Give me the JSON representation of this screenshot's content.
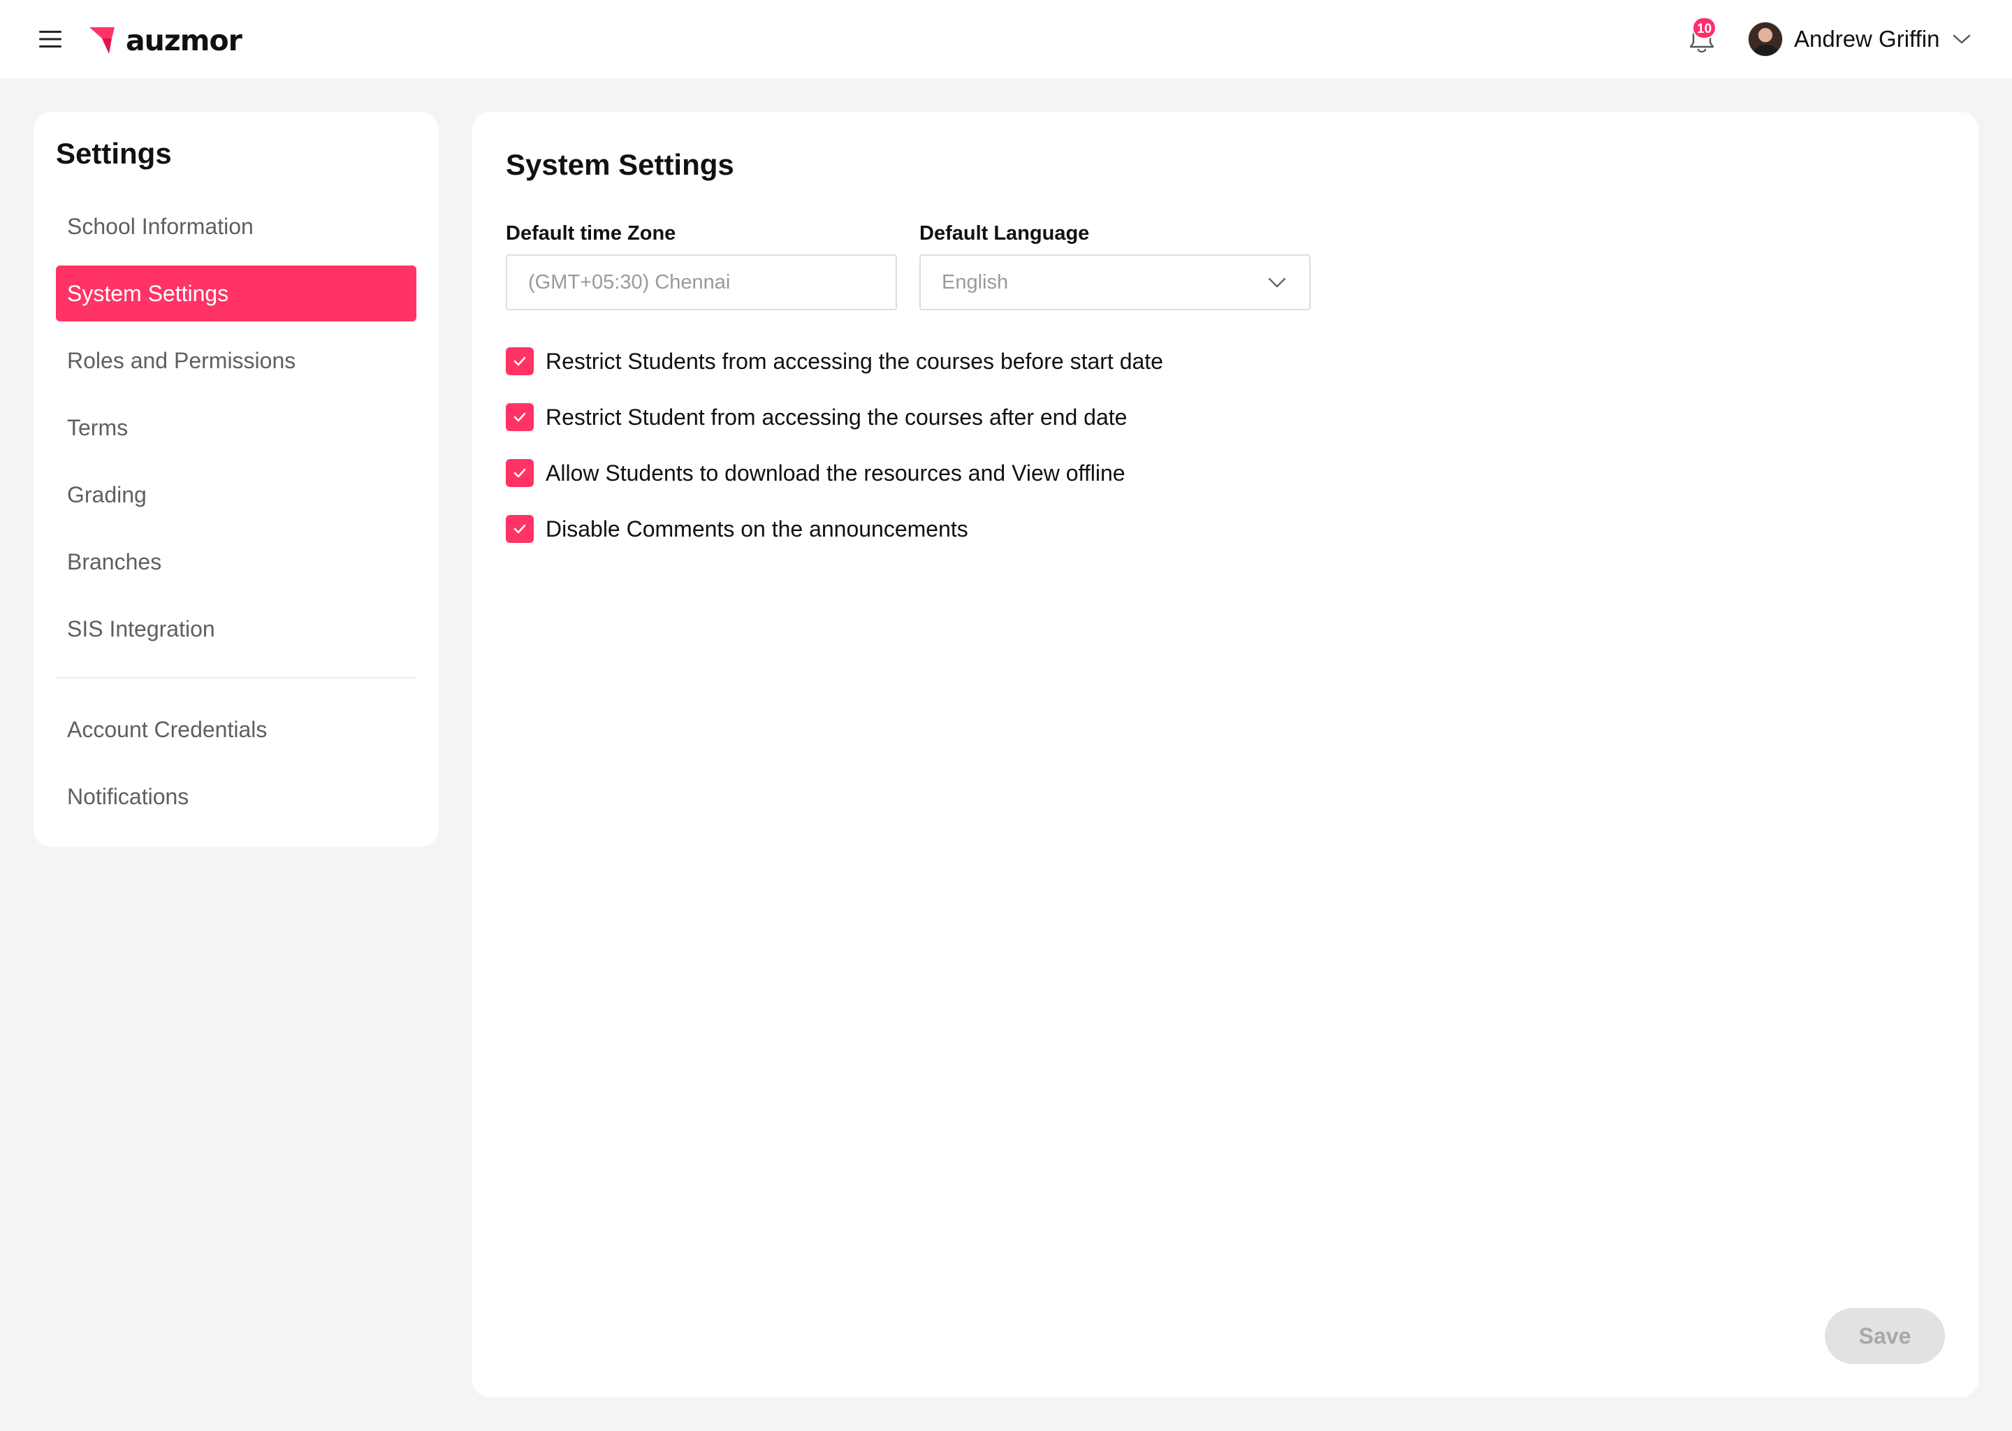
{
  "header": {
    "brand": "auzmor",
    "notification_count": "10",
    "user_name": "Andrew Griffin",
    "icons": {
      "menu": "hamburger-menu-icon",
      "notifications": "bell-icon",
      "user_menu": "chevron-down-icon"
    }
  },
  "sidebar": {
    "title": "Settings",
    "items": [
      {
        "label": "School Information",
        "active": false
      },
      {
        "label": "System Settings",
        "active": true
      },
      {
        "label": "Roles and Permissions",
        "active": false
      },
      {
        "label": "Terms",
        "active": false
      },
      {
        "label": "Grading",
        "active": false
      },
      {
        "label": "Branches",
        "active": false
      },
      {
        "label": "SIS Integration",
        "active": false
      }
    ],
    "secondary_items": [
      {
        "label": "Account Credentials",
        "active": false
      },
      {
        "label": "Notifications",
        "active": false
      }
    ]
  },
  "main": {
    "title": "System Settings",
    "timezone": {
      "label": "Default time Zone",
      "value": "(GMT+05:30) Chennai"
    },
    "language": {
      "label": "Default Language",
      "value": "English"
    },
    "options": [
      {
        "label": "Restrict Students from accessing the courses before start date",
        "checked": true
      },
      {
        "label": "Restrict Student from accessing the courses after end date",
        "checked": true
      },
      {
        "label": "Allow Students to download the resources and View offline",
        "checked": true
      },
      {
        "label": "Disable Comments on the announcements",
        "checked": true
      }
    ],
    "save_label": "Save"
  },
  "colors": {
    "accent": "#ff3366",
    "badge": "#ff2d6a",
    "page_background": "#f4f4f4",
    "disabled_button": "#e2e2e2"
  }
}
